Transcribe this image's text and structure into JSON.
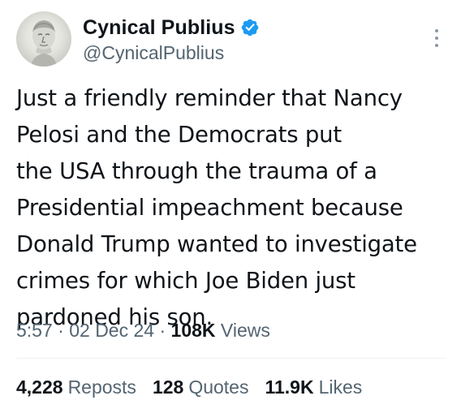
{
  "author": {
    "display_name": "Cynical Publius",
    "handle": "@CynicalPublius",
    "verified": true,
    "avatar_icon": "marble-bust-avatar"
  },
  "tweet": {
    "lines": [
      "Just a friendly reminder that Nancy",
      "Pelosi and the Democrats put",
      "the USA through the trauma of a",
      "Presidential impeachment because",
      "Donald Trump wanted to investigate",
      "crimes for which Joe Biden just",
      "pardoned his son."
    ]
  },
  "meta": {
    "time": "5:57",
    "separator": " · ",
    "date": "02 Dec 24",
    "views_count": "108K",
    "views_label": "Views"
  },
  "stats": {
    "reposts_count": "4,228",
    "reposts_label": "Reposts",
    "quotes_count": "128",
    "quotes_label": "Quotes",
    "likes_count": "11.9K",
    "likes_label": "Likes"
  },
  "colors": {
    "text": "#0f1419",
    "secondary": "#536471",
    "verified": "#1d9bf0",
    "divider": "#eff3f4"
  },
  "icons": {
    "verified": "verified-badge-icon",
    "more": "more-vertical-icon"
  }
}
